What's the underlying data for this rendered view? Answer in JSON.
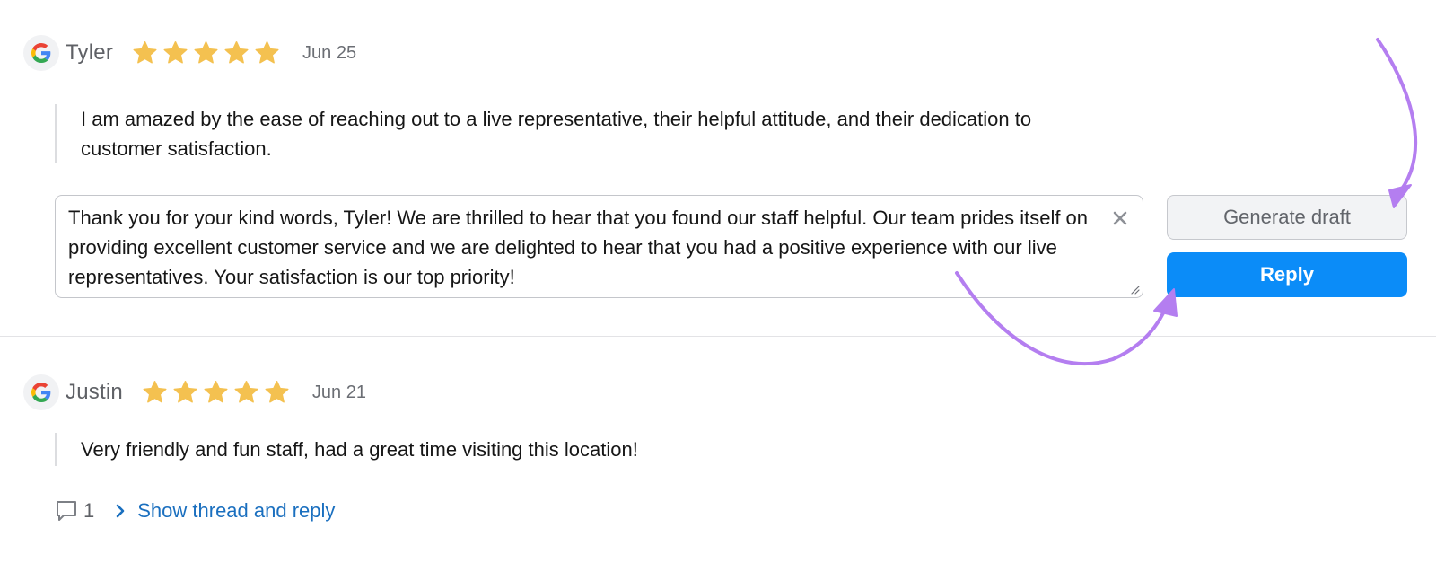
{
  "colors": {
    "star": "#f4c150",
    "reply_button": "#0b8cf8",
    "link": "#1a6fbf",
    "annotation_arrow": "#b47ef0"
  },
  "reviews": [
    {
      "source_icon": "google-logo-icon",
      "author": "Tyler",
      "rating": 5,
      "date": "Jun 25",
      "text": "I am amazed by the ease of reaching out to a live representative, their helpful attitude, and their dedication to customer satisfaction.",
      "reply_draft": "Thank you for your kind words, Tyler! We are thrilled to hear that you found our staff helpful. Our team prides itself on providing excellent customer service and we are delighted to hear that you had a positive experience with our live representatives. Your satisfaction is our top priority!",
      "generate_label": "Generate draft",
      "reply_label": "Reply"
    },
    {
      "source_icon": "google-logo-icon",
      "author": "Justin",
      "rating": 5,
      "date": "Jun 21",
      "text": "Very friendly and fun staff, had a great time visiting this location!",
      "comment_count": "1",
      "thread_link": "Show thread and reply"
    }
  ]
}
